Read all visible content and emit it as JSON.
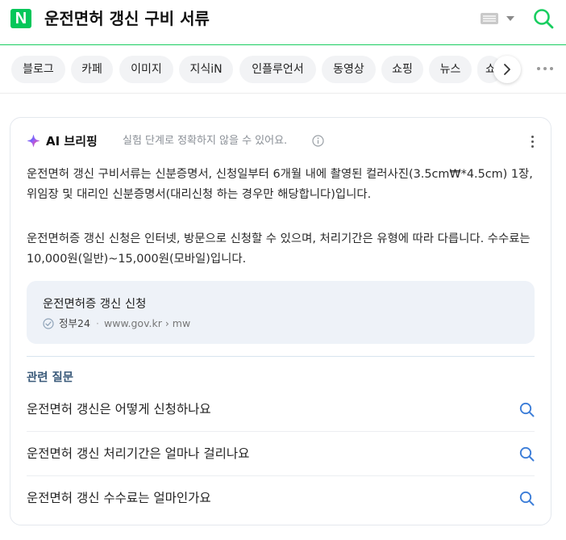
{
  "header": {
    "logo_text": "N",
    "query": "운전면허 갱신 구비 서류",
    "icons": {
      "keyboard": "keyboard-icon",
      "dropdown": "chevron-down-icon",
      "search": "search-icon"
    }
  },
  "tabs": {
    "items": [
      {
        "label": "블로그"
      },
      {
        "label": "카페"
      },
      {
        "label": "이미지"
      },
      {
        "label": "지식iN"
      },
      {
        "label": "인플루언서"
      },
      {
        "label": "동영상"
      },
      {
        "label": "쇼핑"
      },
      {
        "label": "뉴스"
      },
      {
        "label": "쇼"
      }
    ],
    "next_icon": "chevron-right-icon",
    "more_icon": "more-horizontal-icon"
  },
  "ai_briefing": {
    "title": "AI 브리핑",
    "note": "실험 단계로 정확하지 않을 수 있어요.",
    "paragraph1": "운전면허 갱신 구비서류는 신분증명서, 신청일부터 6개월 내에 촬영된 컬러사진(3.5cm₩*4.5cm) 1장, 위임장 및 대리인 신분증명서(대리신청 하는 경우만 해당합니다)입니다.",
    "paragraph2": "운전면허증 갱신 신청은 인터넷, 방문으로 신청할 수 있으며, 처리기간은 유형에 따라 다릅니다. 수수료는 10,000원(일반)~15,000원(모바일)입니다.",
    "source": {
      "title": "운전면허증 갱신 신청",
      "name": "정부24",
      "separator": "·",
      "url": "www.gov.kr › mw"
    },
    "related": {
      "heading": "관련 질문",
      "questions": [
        {
          "text": "운전면허 갱신은 어떻게 신청하나요"
        },
        {
          "text": "운전면허 갱신 처리기간은 얼마나 걸리나요"
        },
        {
          "text": "운전면허 갱신 수수료는 얼마인가요"
        }
      ]
    }
  },
  "colors": {
    "brand_green": "#03c75a",
    "search_accent": "#19ce60",
    "related_icon": "#3d7ed8",
    "source_bg": "#eef2f8",
    "note_gray": "#8a8f96"
  }
}
